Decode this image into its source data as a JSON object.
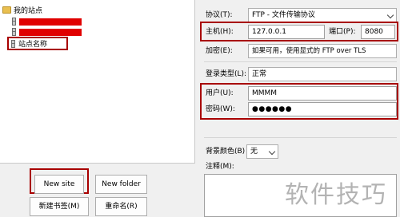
{
  "tree": {
    "root_label": "我的站点",
    "new_site_label": "站点名称"
  },
  "left_buttons": {
    "new_site": "New site",
    "new_folder": "New folder",
    "new_bookmark": "新建书签(M)",
    "rename": "重命名(R)"
  },
  "form": {
    "protocol_label": "协议(T):",
    "protocol_value": "FTP - 文件传输协议",
    "host_label": "主机(H):",
    "host_value": "127.0.0.1",
    "port_label": "端口(P):",
    "port_value": "8080",
    "encryption_label": "加密(E):",
    "encryption_value": "如果可用，使用显式的 FTP over TLS",
    "logon_type_label": "登录类型(L):",
    "logon_type_value": "正常",
    "user_label": "用户(U):",
    "user_value": "MMMM",
    "password_label": "密码(W):",
    "password_value": "●●●●●●",
    "bg_color_label": "背景颜色(B)",
    "bg_color_value": "无",
    "comments_label": "注释(M):"
  },
  "watermark": "软件技巧",
  "colors": {
    "highlight": "#a80000",
    "redaction": "#e00000"
  }
}
